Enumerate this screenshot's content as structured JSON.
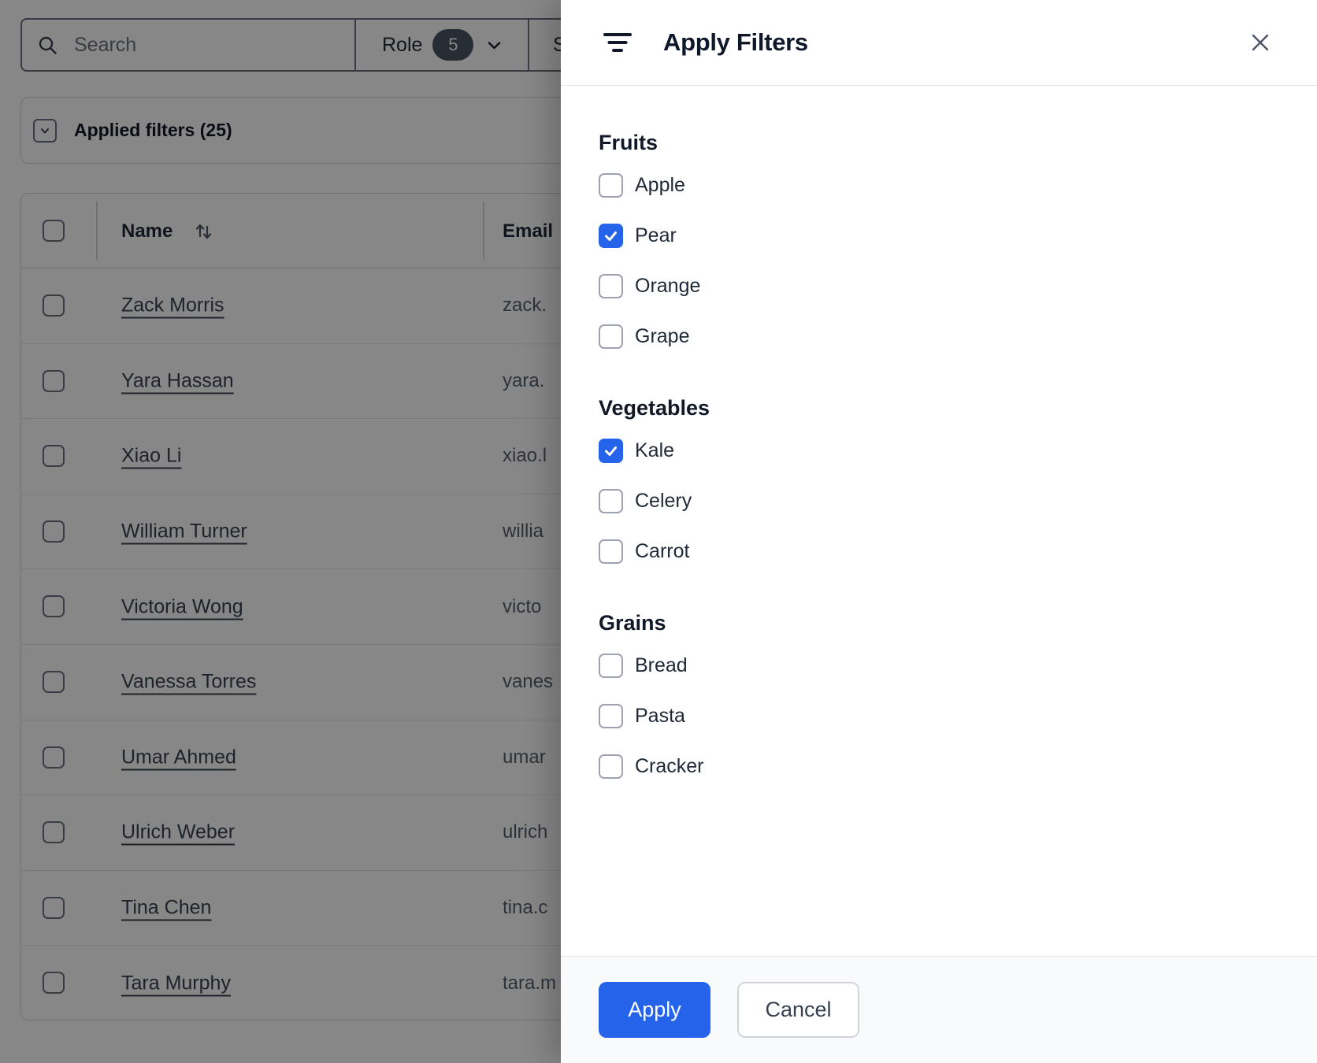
{
  "page": {
    "search": {
      "placeholder": "Search",
      "icon": "magnifier"
    },
    "filter_bar": {
      "role_label": "Role",
      "role_count": "5",
      "clipped_segment_label": "S"
    },
    "applied_filters": {
      "label": "Applied filters (25)"
    },
    "table": {
      "columns": [
        {
          "label": "Name",
          "sortable": true
        },
        {
          "label": "Email",
          "sortable": false
        }
      ],
      "rows": [
        {
          "name": "Zack Morris",
          "email_fragment": "zack."
        },
        {
          "name": "Yara Hassan",
          "email_fragment": "yara."
        },
        {
          "name": "Xiao Li",
          "email_fragment": "xiao.l"
        },
        {
          "name": "William Turner",
          "email_fragment": "willia"
        },
        {
          "name": "Victoria Wong",
          "email_fragment": "victo"
        },
        {
          "name": "Vanessa Torres",
          "email_fragment": "vanes"
        },
        {
          "name": "Umar Ahmed",
          "email_fragment": "umar"
        },
        {
          "name": "Ulrich Weber",
          "email_fragment": "ulrich"
        },
        {
          "name": "Tina Chen",
          "email_fragment": "tina.c"
        },
        {
          "name": "Tara Murphy",
          "email_fragment": "tara.m"
        }
      ]
    }
  },
  "panel": {
    "title": "Apply Filters",
    "sections": [
      {
        "heading": "Fruits",
        "options": [
          {
            "label": "Apple",
            "checked": false
          },
          {
            "label": "Pear",
            "checked": true
          },
          {
            "label": "Orange",
            "checked": false
          },
          {
            "label": "Grape",
            "checked": false
          }
        ]
      },
      {
        "heading": "Vegetables",
        "options": [
          {
            "label": "Kale",
            "checked": true
          },
          {
            "label": "Celery",
            "checked": false
          },
          {
            "label": "Carrot",
            "checked": false
          }
        ]
      },
      {
        "heading": "Grains",
        "options": [
          {
            "label": "Bread",
            "checked": false
          },
          {
            "label": "Pasta",
            "checked": false
          },
          {
            "label": "Cracker",
            "checked": false
          }
        ]
      }
    ],
    "footer": {
      "apply_label": "Apply",
      "cancel_label": "Cancel"
    }
  },
  "colors": {
    "accent_blue": "#2563eb",
    "badge_dark": "#4b5563",
    "checkbox_border": "#9ca3af",
    "overlay": "rgba(0,0,0,0.47)"
  }
}
